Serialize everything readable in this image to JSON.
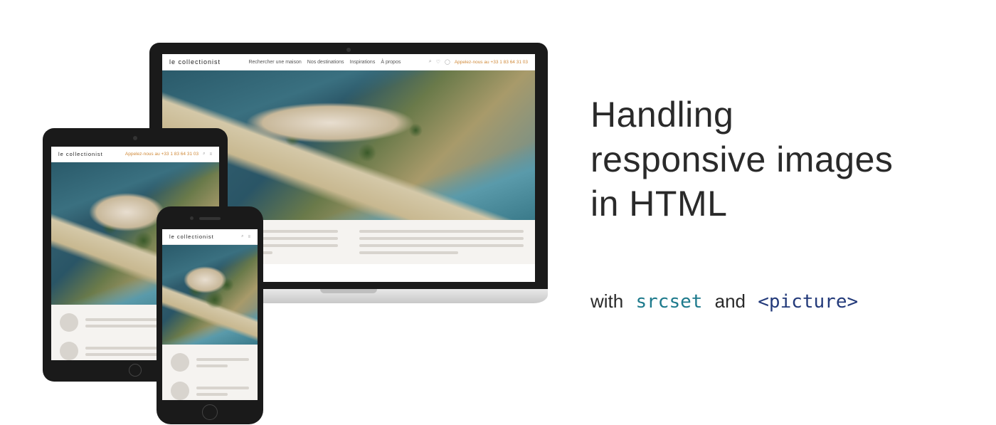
{
  "title_line1": "Handling",
  "title_line2": "responsive images",
  "title_line3": "in HTML",
  "subtitle_with": "with",
  "subtitle_code1": "srcset",
  "subtitle_and": "and",
  "subtitle_code2": "<picture>",
  "site": {
    "brand": "le collectionist",
    "nav": {
      "search_house": "Rechercher une maison",
      "destinations": "Nos destinations",
      "inspirations": "Inspirations",
      "about": "À propos"
    },
    "call_prefix": "Appelez-nous au ",
    "call_number": "+33 1 83 64 31 03"
  }
}
